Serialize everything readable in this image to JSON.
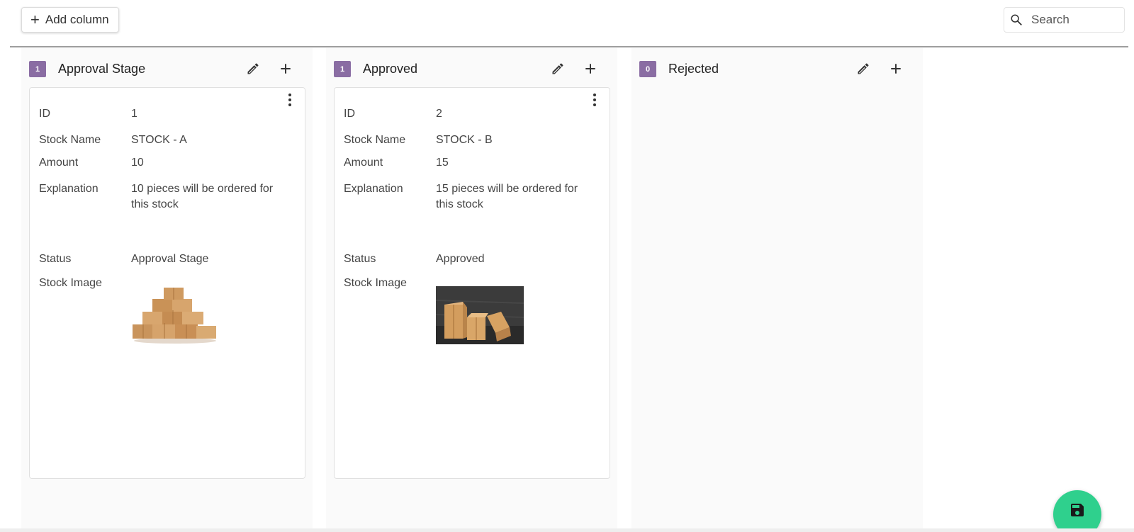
{
  "toolbar": {
    "add_column_label": "Add column",
    "search_placeholder": "Search"
  },
  "columns": [
    {
      "count": "1",
      "title": "Approval Stage",
      "card": {
        "id_label": "ID",
        "id": "1",
        "stock_name_label": "Stock Name",
        "stock_name": "STOCK - A",
        "amount_label": "Amount",
        "amount": "10",
        "explanation_label": "Explanation",
        "explanation": "10 pieces will be ordered for this stock",
        "status_label": "Status",
        "status": "Approval Stage",
        "stock_image_label": "Stock Image"
      }
    },
    {
      "count": "1",
      "title": "Approved",
      "card": {
        "id_label": "ID",
        "id": "2",
        "stock_name_label": "Stock Name",
        "stock_name": "STOCK - B",
        "amount_label": "Amount",
        "amount": "15",
        "explanation_label": "Explanation",
        "explanation": "15 pieces will be ordered for this stock",
        "status_label": "Status",
        "status": "Approved",
        "stock_image_label": "Stock Image"
      }
    },
    {
      "count": "0",
      "title": "Rejected"
    }
  ],
  "icons": {
    "add": "plus-icon",
    "search": "search-icon",
    "edit": "pencil-icon",
    "menu": "more-vertical-icon",
    "save": "floppy-disk-icon"
  },
  "colors": {
    "badge": "#8a6da3",
    "fab": "#2fd08d",
    "column_bg": "#fafafa"
  }
}
